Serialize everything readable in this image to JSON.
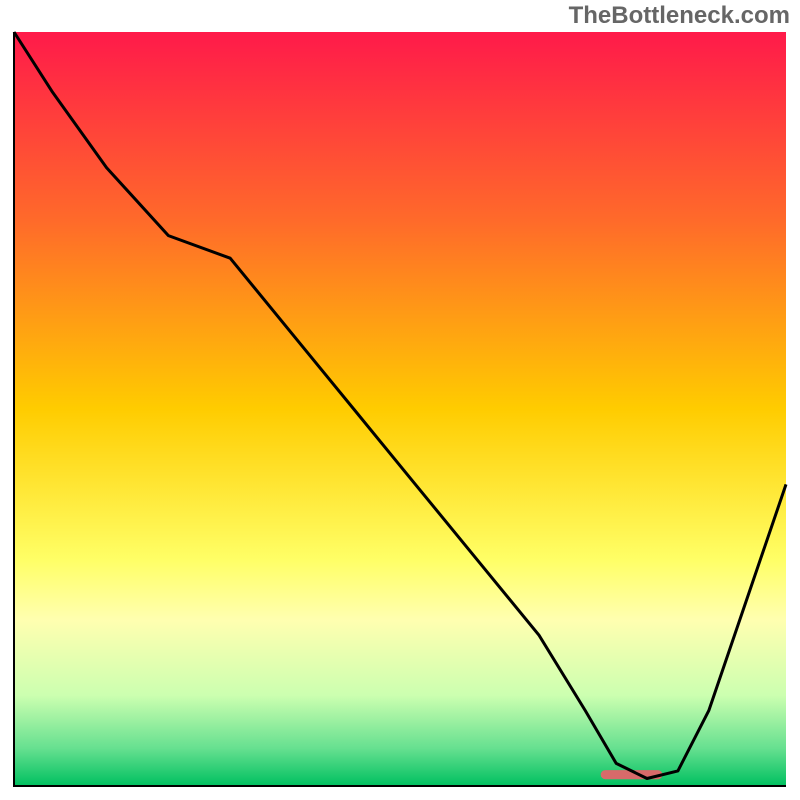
{
  "watermark": "TheBottleneck.com",
  "chart_data": {
    "type": "line",
    "title": "",
    "xlabel": "",
    "ylabel": "",
    "xlim": [
      0,
      100
    ],
    "ylim": [
      0,
      100
    ],
    "gradient_stops": [
      {
        "offset": 0,
        "color": "#ff1a4a"
      },
      {
        "offset": 25,
        "color": "#ff6a2a"
      },
      {
        "offset": 50,
        "color": "#ffcc00"
      },
      {
        "offset": 70,
        "color": "#ffff66"
      },
      {
        "offset": 78,
        "color": "#ffffb0"
      },
      {
        "offset": 88,
        "color": "#ccffb0"
      },
      {
        "offset": 95,
        "color": "#66e090"
      },
      {
        "offset": 100,
        "color": "#00c060"
      }
    ],
    "series": [
      {
        "name": "bottleneck-curve",
        "x": [
          0,
          5,
          12,
          20,
          28,
          36,
          44,
          52,
          60,
          68,
          74,
          78,
          82,
          86,
          90,
          95,
          100
        ],
        "y": [
          100,
          92,
          82,
          73,
          70,
          60,
          50,
          40,
          30,
          20,
          10,
          3,
          1,
          2,
          10,
          25,
          40
        ]
      }
    ],
    "marker": {
      "name": "highlight-segment",
      "x_center": 80,
      "y_center": 1.5,
      "width": 8,
      "height": 1.2,
      "color": "#d86a6a"
    },
    "frame": {
      "stroke": "#000000",
      "stroke_width": 2
    }
  }
}
